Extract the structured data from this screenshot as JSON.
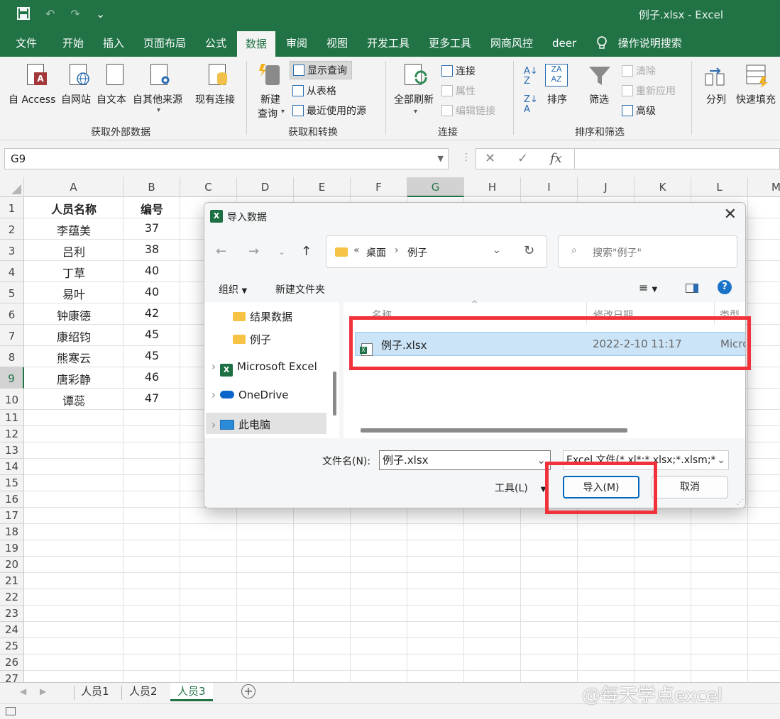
{
  "window": {
    "title": "例子.xlsx  -  Excel"
  },
  "qat": {
    "save_icon": "save-icon",
    "undo": "↶",
    "redo": "↷",
    "more": "⌄"
  },
  "tabs": [
    "文件",
    "开始",
    "插入",
    "页面布局",
    "公式",
    "数据",
    "审阅",
    "视图",
    "开发工具",
    "更多工具",
    "网商风控",
    "deer",
    "操作说明搜索"
  ],
  "active_tab": "数据",
  "ribbon": {
    "get_external": {
      "access": "自 Access",
      "web": "自网站",
      "text": "自文本",
      "other": "自其他来源",
      "existing": "现有连接",
      "label": "获取外部数据"
    },
    "get_transform": {
      "new_query_1": "新建",
      "new_query_2": "查询",
      "show_queries": "显示查询",
      "from_table": "从表格",
      "recent_sources": "最近使用的源",
      "label": "获取和转换"
    },
    "connections": {
      "refresh_all": "全部刷新",
      "connections": "连接",
      "properties": "属性",
      "edit_links": "编辑链接",
      "label": "连接"
    },
    "sort_filter": {
      "sort": "排序",
      "filter": "筛选",
      "clear": "清除",
      "reapply": "重新应用",
      "advanced": "高级",
      "label": "排序和筛选"
    },
    "tools": {
      "text_to_columns": "分列",
      "flash_fill": "快速填充"
    }
  },
  "formula_bar": {
    "name_box": "G9",
    "fx": "fx"
  },
  "columns": [
    "A",
    "B",
    "C",
    "D",
    "E",
    "F",
    "G",
    "H",
    "I",
    "J",
    "K",
    "L",
    "M"
  ],
  "selected_column": "G",
  "selected_row": "9",
  "rows": [
    "1",
    "2",
    "3",
    "4",
    "5",
    "6",
    "7",
    "8",
    "9",
    "10",
    "11",
    "12",
    "13",
    "14",
    "15",
    "16",
    "17",
    "18",
    "19",
    "20",
    "21",
    "22",
    "23",
    "24",
    "25",
    "26",
    "27"
  ],
  "sheet": {
    "headers": [
      "人员名称",
      "编号"
    ],
    "data": [
      [
        "李蕴美",
        "37"
      ],
      [
        "吕利",
        "38"
      ],
      [
        "丁草",
        "40"
      ],
      [
        "易叶",
        "40"
      ],
      [
        "钟康德",
        "42"
      ],
      [
        "康绍钧",
        "45"
      ],
      [
        "熊寒云",
        "45"
      ],
      [
        "唐彩静",
        "46"
      ],
      [
        "谭蕊",
        "47"
      ]
    ]
  },
  "sheet_tabs": [
    "人员1",
    "人员2",
    "人员3"
  ],
  "active_sheet": "人员3",
  "watermark": "@每天学点excel",
  "dialog": {
    "title": "导入数据",
    "breadcrumb": [
      "«",
      "桌面",
      "例子"
    ],
    "search_placeholder": "搜索\"例子\"",
    "organize": "组织",
    "new_folder": "新建文件夹",
    "nav": [
      "结果数据",
      "例子",
      "Microsoft Excel",
      "OneDrive",
      "此电脑"
    ],
    "list_headers": [
      "名称",
      "修改日期",
      "类型"
    ],
    "file": {
      "name": "例子.xlsx",
      "date": "2022-2-10 11:17",
      "type": "Micro"
    },
    "filename_label": "文件名(N):",
    "filename_value": "例子.xlsx",
    "filetype": "Excel 文件(*.xl*;*.xlsx;*.xlsm;*",
    "tools": "工具(L)",
    "import_button": "导入(M)",
    "cancel_button": "取消"
  }
}
